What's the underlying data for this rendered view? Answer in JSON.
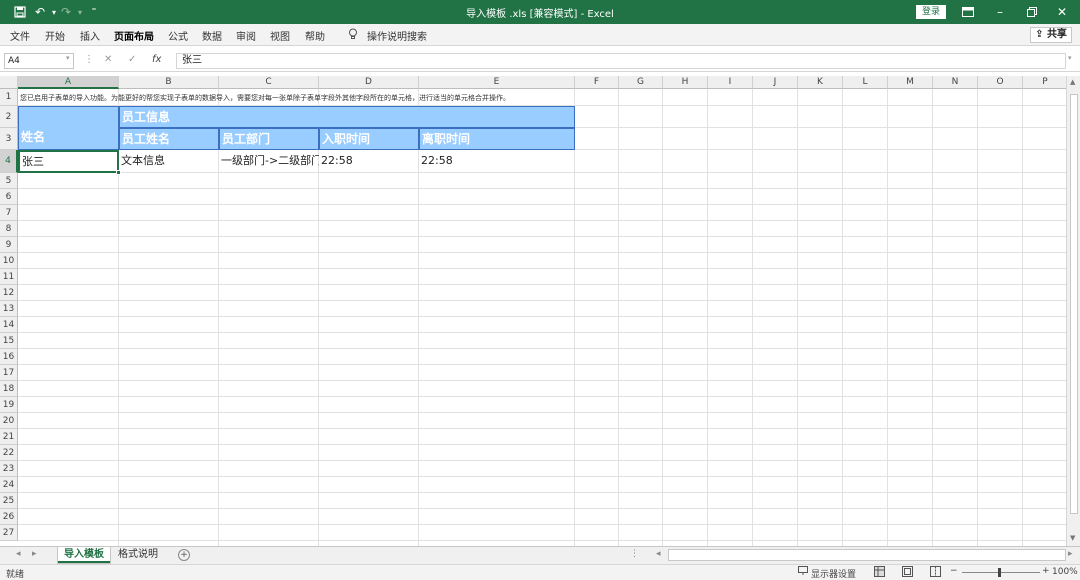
{
  "window": {
    "title": "导入模板 .xls  [兼容模式]  -  Excel",
    "login_label": "登录"
  },
  "titlebar_icons": [
    "save-icon",
    "undo-icon",
    "redo-icon",
    "customize-icon"
  ],
  "menu": {
    "items": [
      "文件",
      "开始",
      "插入",
      "页面布局",
      "公式",
      "数据",
      "审阅",
      "视图",
      "帮助"
    ],
    "active_index": 3,
    "search_label": "操作说明搜索",
    "share_label": "共享"
  },
  "formula_bar": {
    "name_box": "A4",
    "fx_label": "fx",
    "content": "张三"
  },
  "columns": [
    "A",
    "B",
    "C",
    "D",
    "E",
    "F",
    "G",
    "H",
    "I",
    "J",
    "K",
    "L",
    "M",
    "N",
    "O",
    "P"
  ],
  "selected_column": "A",
  "selected_row": 4,
  "rows": [
    "1",
    "2",
    "3",
    "4",
    "5",
    "6",
    "7",
    "8",
    "9",
    "10",
    "11",
    "12",
    "13",
    "14",
    "15",
    "16",
    "17",
    "18",
    "19",
    "20",
    "21",
    "22",
    "23",
    "24",
    "25",
    "26",
    "27"
  ],
  "sheet": {
    "note": "您已启用子表单的导入功能。为能更好的帮您实现子表单的数据导入，需要您对每一张单除子表单字段外其他字段所在的单元格，进行适当的单元格合并操作。",
    "a23_label": "姓名",
    "group_header": "员工信息",
    "sub_headers": [
      "员工姓名",
      "员工部门",
      "入职时间",
      "离职时间"
    ],
    "row4": [
      "张三",
      "文本信息",
      "一级部门->二级部门",
      "22:58",
      "22:58"
    ]
  },
  "tabs": {
    "items": [
      "导入模板",
      "格式说明"
    ],
    "active_index": 0,
    "add_label": "+"
  },
  "status": {
    "ready": "就绪",
    "display_settings": "显示器设置",
    "zoom": "100%",
    "zoom_minus": "−",
    "zoom_plus": "+"
  },
  "colors": {
    "accent": "#217346",
    "header_fill": "#99ccff",
    "header_border": "#3b6fc0"
  }
}
